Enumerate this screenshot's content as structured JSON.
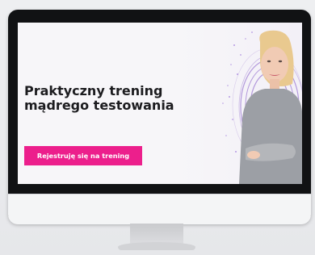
{
  "banner": {
    "headline_line1": "Praktyczny trening",
    "headline_line2": "mądrego testowania",
    "cta_label": "Rejestruję się na trening"
  },
  "colors": {
    "accent": "#ec1f8c",
    "bezel": "#111214",
    "swirl": "#7b4fc4"
  },
  "icons": {
    "illustration": "woman-portrait",
    "decoration": "purple-swirl"
  }
}
